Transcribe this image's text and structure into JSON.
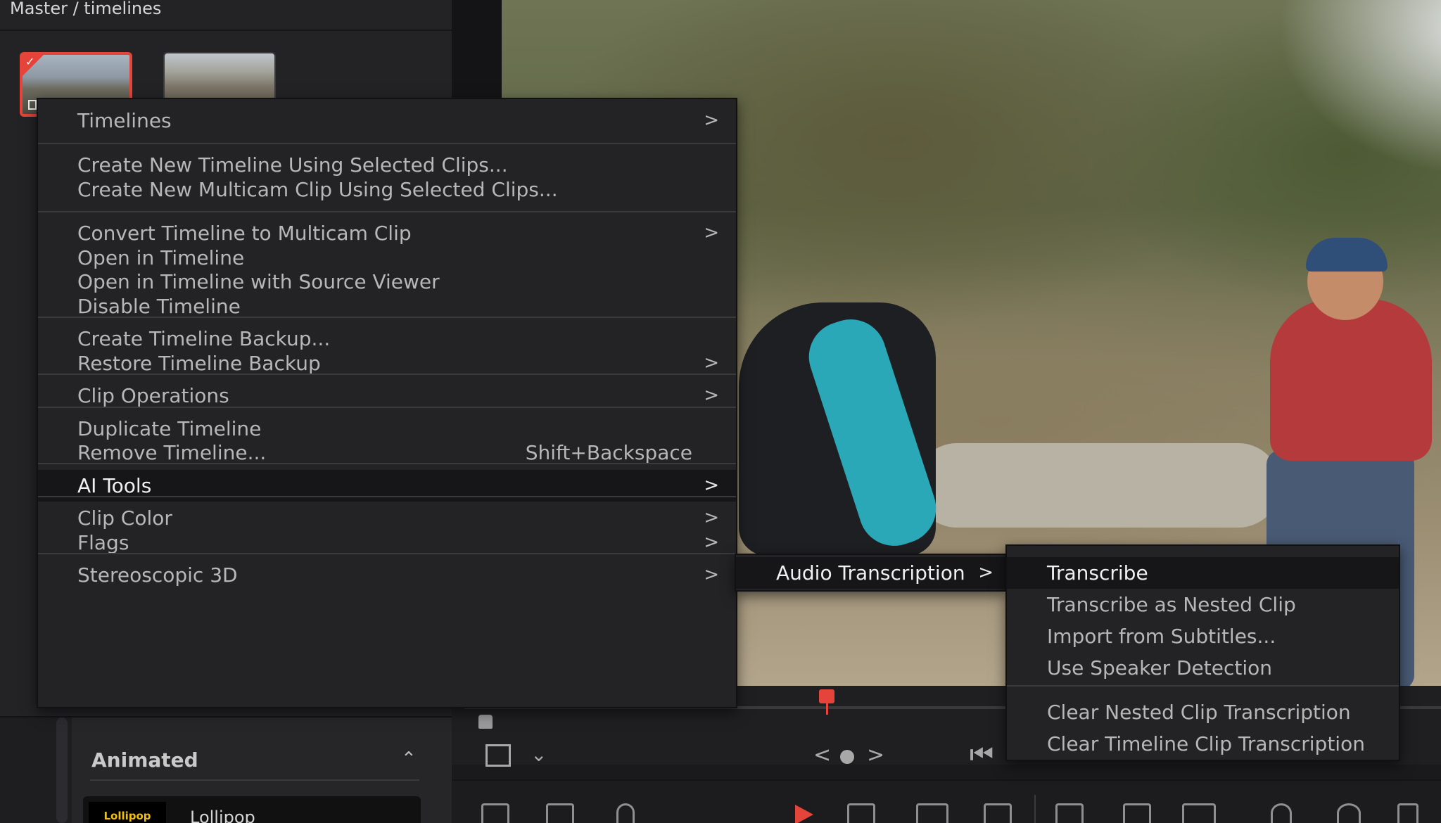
{
  "media_pool": {
    "breadcrumb": "Master / timelines"
  },
  "effects": {
    "section_title": "Animated",
    "collapse_icon": "chevron-up-icon",
    "first_item_badge": "Lollipop",
    "first_item_name": "Lollipop"
  },
  "menu": {
    "items": [
      {
        "label": "Timelines",
        "has_submenu": true
      },
      {
        "label": "Create New Timeline Using Selected Clips..."
      },
      {
        "label": "Create New Multicam Clip Using Selected Clips..."
      },
      {
        "label": "Convert Timeline to Multicam Clip",
        "has_submenu": true
      },
      {
        "label": "Open in Timeline"
      },
      {
        "label": "Open in Timeline with Source Viewer"
      },
      {
        "label": "Disable Timeline"
      },
      {
        "label": "Create Timeline Backup..."
      },
      {
        "label": "Restore Timeline Backup",
        "has_submenu": true
      },
      {
        "label": "Clip Operations",
        "has_submenu": true
      },
      {
        "label": "Duplicate Timeline"
      },
      {
        "label": "Remove Timeline...",
        "shortcut": "Shift+Backspace"
      },
      {
        "label": "AI Tools",
        "has_submenu": true,
        "highlighted": true
      },
      {
        "label": "Clip Color",
        "has_submenu": true
      },
      {
        "label": "Flags",
        "has_submenu": true
      },
      {
        "label": "Stereoscopic 3D",
        "has_submenu": true
      }
    ],
    "arrow_glyph": ">"
  },
  "submenu": {
    "items": [
      {
        "label": "Audio Transcription",
        "has_submenu": true,
        "highlighted": true
      }
    ]
  },
  "submenu2": {
    "items": [
      {
        "label": "Transcribe",
        "highlighted": true
      },
      {
        "label": "Transcribe as Nested Clip"
      },
      {
        "label": "Import from Subtitles..."
      },
      {
        "label": "Use Speaker Detection"
      },
      {
        "label": "Clear Nested Clip Transcription"
      },
      {
        "label": "Clear Timeline Clip Transcription"
      }
    ]
  },
  "transport": {
    "prev_glyph": "<",
    "next_glyph": ">",
    "chevron_glyph": "⌄",
    "skip_start_glyph": "⏮"
  },
  "colors": {
    "accent": "#e5443b",
    "menu_bg": "#232325",
    "menu_highlight": "#161618",
    "teal": "#2aa8b8"
  }
}
